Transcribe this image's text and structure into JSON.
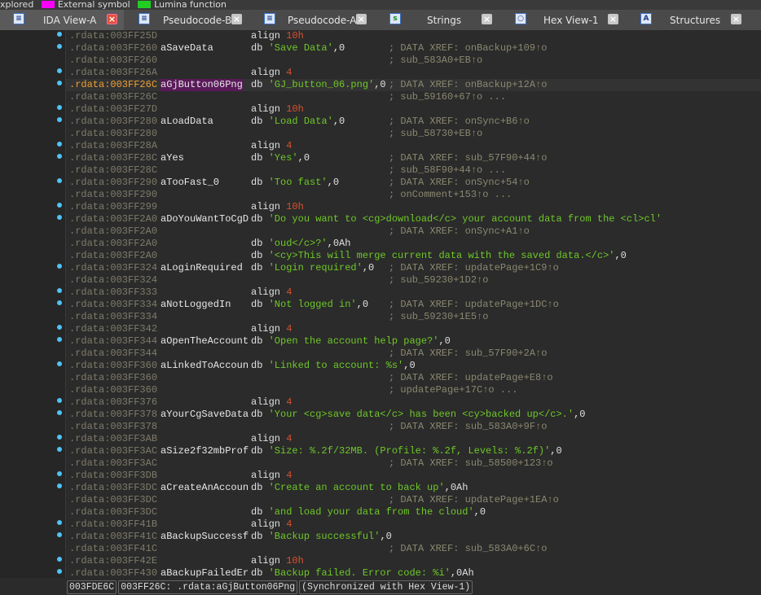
{
  "legend": [
    {
      "label": "xplored",
      "color": ""
    },
    {
      "label": "External symbol",
      "color": "#ff00ff"
    },
    {
      "label": "Lumina function",
      "color": "#22cc22"
    }
  ],
  "tabs": [
    {
      "label": "IDA View-A",
      "icon": "disassembly-icon",
      "glyph": "≡",
      "active": true
    },
    {
      "label": "Pseudocode-B",
      "icon": "pseudocode-icon",
      "glyph": "≡",
      "active": false
    },
    {
      "label": "Pseudocode-A",
      "icon": "pseudocode-icon",
      "glyph": "≡",
      "active": false
    },
    {
      "label": "Strings",
      "icon": "strings-icon",
      "glyph": "s",
      "active": false
    },
    {
      "label": "Hex View-1",
      "icon": "hex-view-icon",
      "glyph": "○",
      "active": false
    },
    {
      "label": "Structures",
      "icon": "structures-icon",
      "glyph": "A",
      "active": false
    }
  ],
  "colors": {
    "accent_label_bg": "#5a1a5a",
    "string": "#6ec828",
    "number": "#d8502c",
    "address_current": "#f0a030",
    "bullet": "#4fc3f7"
  },
  "listing": [
    {
      "addr": ".rdata:003FF25D",
      "label": "",
      "op": "align",
      "num": "10h",
      "dot": true
    },
    {
      "addr": ".rdata:003FF260",
      "label": "aSaveData",
      "op": "db",
      "str": "'Save Data'",
      "tail": ",0",
      "cmt": "; DATA XREF: onBackup+109↑o",
      "dot": true
    },
    {
      "addr": ".rdata:003FF260",
      "cmt": "; sub_583A0+EB↑o"
    },
    {
      "addr": ".rdata:003FF26A",
      "op": "align",
      "num": "4",
      "dot": true
    },
    {
      "addr": ".rdata:003FF26C",
      "label": "aGjButton06Png",
      "op": "db",
      "str": "'GJ_button_06.png'",
      "tail": ",0",
      "cmt": "; DATA XREF: onBackup+12A↑o",
      "dot": true,
      "current": true
    },
    {
      "addr": ".rdata:003FF26C",
      "cmt": "; sub_59160+67↑o ..."
    },
    {
      "addr": ".rdata:003FF27D",
      "op": "align",
      "num": "10h",
      "dot": true
    },
    {
      "addr": ".rdata:003FF280",
      "label": "aLoadData",
      "op": "db",
      "str": "'Load Data'",
      "tail": ",0",
      "cmt": "; DATA XREF: onSync+B6↑o",
      "dot": true
    },
    {
      "addr": ".rdata:003FF280",
      "cmt": "; sub_58730+EB↑o"
    },
    {
      "addr": ".rdata:003FF28A",
      "op": "align",
      "num": "4",
      "dot": true
    },
    {
      "addr": ".rdata:003FF28C",
      "label": "aYes",
      "op": "db",
      "str": "'Yes'",
      "tail": ",0",
      "cmt": "; DATA XREF: sub_57F90+44↑o",
      "dot": true
    },
    {
      "addr": ".rdata:003FF28C",
      "cmt": "; sub_58F90+44↑o ..."
    },
    {
      "addr": ".rdata:003FF290",
      "label": "aTooFast_0",
      "op": "db",
      "str": "'Too fast'",
      "tail": ",0",
      "cmt": "; DATA XREF: onSync+54↑o",
      "dot": true
    },
    {
      "addr": ".rdata:003FF290",
      "cmt": "; onComment+153↑o ..."
    },
    {
      "addr": ".rdata:003FF299",
      "op": "align",
      "num": "10h",
      "dot": true
    },
    {
      "addr": ".rdata:003FF2A0",
      "label": "aDoYouWantToCgD",
      "op": "db",
      "str": "'Do you want to <cg>download</c> your account data from the <cl>cl'",
      "dot": true
    },
    {
      "addr": ".rdata:003FF2A0",
      "cmt": "; DATA XREF: onSync+A1↑o"
    },
    {
      "addr": ".rdata:003FF2A0",
      "op": "db",
      "str": "'oud</c>?'",
      "tail": ",0Ah"
    },
    {
      "addr": ".rdata:003FF2A0",
      "op": "db",
      "str": "'<cy>This will merge current data with the saved data.</c>'",
      "tail": ",0"
    },
    {
      "addr": ".rdata:003FF324",
      "label": "aLoginRequired",
      "op": "db",
      "str": "'Login required'",
      "tail": ",0",
      "cmt": "; DATA XREF: updatePage+1C9↑o",
      "dot": true
    },
    {
      "addr": ".rdata:003FF324",
      "cmt": "; sub_59230+1D2↑o"
    },
    {
      "addr": ".rdata:003FF333",
      "op": "align",
      "num": "4",
      "dot": true
    },
    {
      "addr": ".rdata:003FF334",
      "label": "aNotLoggedIn",
      "op": "db",
      "str": "'Not logged in'",
      "tail": ",0",
      "cmt": "; DATA XREF: updatePage+1DC↑o",
      "dot": true
    },
    {
      "addr": ".rdata:003FF334",
      "cmt": "; sub_59230+1E5↑o"
    },
    {
      "addr": ".rdata:003FF342",
      "op": "align",
      "num": "4",
      "dot": true
    },
    {
      "addr": ".rdata:003FF344",
      "label": "aOpenTheAccount",
      "op": "db",
      "str": "'Open the account help page?'",
      "tail": ",0",
      "dot": true
    },
    {
      "addr": ".rdata:003FF344",
      "cmt": "; DATA XREF: sub_57F90+2A↑o"
    },
    {
      "addr": ".rdata:003FF360",
      "label": "aLinkedToAccoun",
      "op": "db",
      "str": "'Linked to account: %s'",
      "tail": ",0",
      "dot": true
    },
    {
      "addr": ".rdata:003FF360",
      "cmt": "; DATA XREF: updatePage+E8↑o"
    },
    {
      "addr": ".rdata:003FF360",
      "cmt": "; updatePage+17C↑o ..."
    },
    {
      "addr": ".rdata:003FF376",
      "op": "align",
      "num": "4",
      "dot": true
    },
    {
      "addr": ".rdata:003FF378",
      "label": "aYourCgSaveData",
      "op": "db",
      "str": "'Your <cg>save data</c> has been <cy>backed up</c>.'",
      "tail": ",0",
      "dot": true
    },
    {
      "addr": ".rdata:003FF378",
      "cmt": "; DATA XREF: sub_583A0+9F↑o"
    },
    {
      "addr": ".rdata:003FF3AB",
      "op": "align",
      "num": "4",
      "dot": true
    },
    {
      "addr": ".rdata:003FF3AC",
      "label": "aSize2f32mbProf",
      "op": "db",
      "str": "'Size: %.2f/32MB. (Profile: %.2f, Levels: %.2f)'",
      "tail": ",0",
      "dot": true
    },
    {
      "addr": ".rdata:003FF3AC",
      "cmt": "; DATA XREF: sub_58500+123↑o"
    },
    {
      "addr": ".rdata:003FF3DB",
      "op": "align",
      "num": "4",
      "dot": true
    },
    {
      "addr": ".rdata:003FF3DC",
      "label": "aCreateAnAccoun",
      "op": "db",
      "str": "'Create an account to back up'",
      "tail": ",0Ah",
      "dot": true
    },
    {
      "addr": ".rdata:003FF3DC",
      "cmt": "; DATA XREF: updatePage+1EA↑o"
    },
    {
      "addr": ".rdata:003FF3DC",
      "op": "db",
      "str": "'and load your data from the cloud'",
      "tail": ",0"
    },
    {
      "addr": ".rdata:003FF41B",
      "op": "align",
      "num": "4",
      "dot": true
    },
    {
      "addr": ".rdata:003FF41C",
      "label": "aBackupSuccessf",
      "op": "db",
      "str": "'Backup successful'",
      "tail": ",0",
      "dot": true
    },
    {
      "addr": ".rdata:003FF41C",
      "cmt": "; DATA XREF: sub_583A0+6C↑o"
    },
    {
      "addr": ".rdata:003FF42E",
      "op": "align",
      "num": "10h",
      "dot": true
    },
    {
      "addr": ".rdata:003FF430",
      "label": "aBackupFailedEr",
      "op": "db",
      "str": "'Backup failed. Error code: %i'",
      "tail": ",0Ah",
      "dot": true
    }
  ],
  "status": {
    "offset": "003FDE6C",
    "location": "003FF26C: .rdata:aGjButton06Png",
    "sync": "(Synchronized with Hex View-1)"
  }
}
